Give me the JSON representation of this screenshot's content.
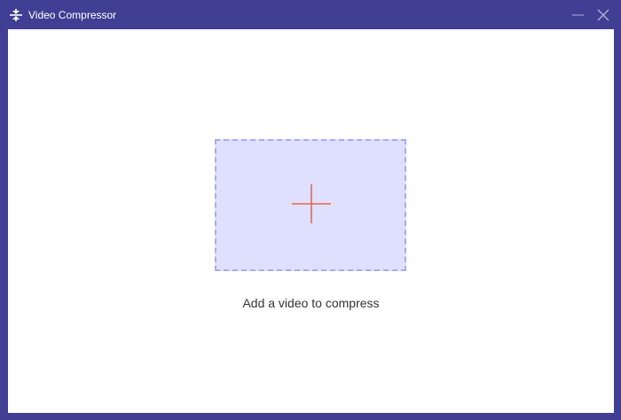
{
  "window": {
    "title": "Video Compressor",
    "app_icon": "compress-icon",
    "controls": {
      "minimize_icon": "minimize-icon",
      "close_icon": "close-icon"
    }
  },
  "colors": {
    "titlebar": "#403f94",
    "dropzone_fill": "#dfe0fd",
    "dropzone_border": "#a7aaf5",
    "plus": "#f06448"
  },
  "main": {
    "dropzone_icon": "plus-icon",
    "hint": "Add a video to compress"
  }
}
